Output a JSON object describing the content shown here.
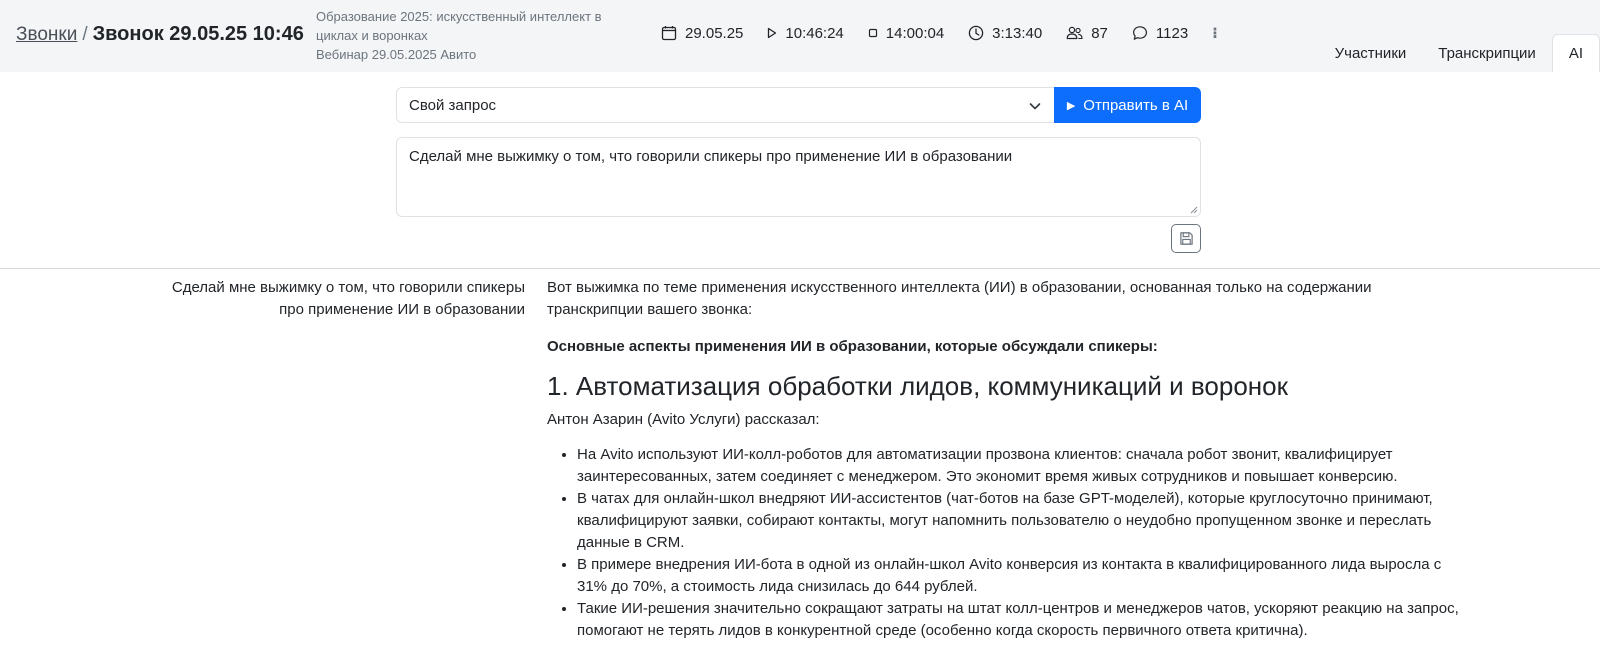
{
  "header": {
    "breadcrumb_link": "Звонки",
    "breadcrumb_sep": "/",
    "title": "Звонок 29.05.25 10:46",
    "meta_title": "Образование 2025: искусственный интеллект в циклах и воронках",
    "meta_subtitle": "Вебинар 29.05.2025 Авито",
    "stats": {
      "date": "29.05.25",
      "start_time": "10:46:24",
      "end_time": "14:00:04",
      "duration": "3:13:40",
      "participants": "87",
      "messages": "1123",
      "more": "⁝"
    },
    "tabs": [
      {
        "label": "Участники",
        "active": false
      },
      {
        "label": "Транскрипции",
        "active": false
      },
      {
        "label": "AI",
        "active": true
      }
    ]
  },
  "query": {
    "select_value": "Свой запрос",
    "send_label": "Отправить в AI",
    "prompt_text": "Сделай мне выжимку о том, что говорили спикеры про применение ИИ в образовании"
  },
  "conversation": {
    "question": "Сделай мне выжимку о том, что говорили спикеры про применение ИИ в образовании",
    "intro": "Вот выжимка по теме применения искусственного интеллекта (ИИ) в образовании, основанная только на содержании транскрипции вашего звонка:",
    "section_heading": "Основные аспекты применения ИИ в образовании, которые обсуждали спикеры:",
    "h1": "1. Автоматизация обработки лидов, коммуникаций и воронок",
    "speaker_line": "Антон Азарин (Avito Услуги) рассказал:",
    "bullets": [
      "На Avito используют ИИ-колл-роботов для автоматизации прозвона клиентов: сначала робот звонит, квалифицирует заинтересованных, затем соединяет с менеджером. Это экономит время живых сотрудников и повышает конверсию.",
      "В чатах для онлайн-школ внедряют ИИ-ассистентов (чат-ботов на базе GPT-моделей), которые круглосуточно принимают, квалифицируют заявки, собирают контакты, могут напомнить пользователю о неудобно пропущенном звонке и переслать данные в CRM.",
      "В примере внедрения ИИ-бота в одной из онлайн-школ Avito конверсия из контакта в квалифицированного лида выросла с 31% до 70%, а стоимость лида снизилась до 644 рублей.",
      "Такие ИИ-решения значительно сокращают затраты на штат колл-центров и менеджеров чатов, ускоряют реакцию на запрос, помогают не терять лидов в конкурентной среде (особенно когда скорость первичного ответа критична)."
    ]
  },
  "colors": {
    "accent": "#0d6efd",
    "header_bg": "#f4f5f7",
    "text": "#212529",
    "muted": "#6c757d"
  },
  "icons": [
    "calendar-icon",
    "play-icon",
    "stop-icon",
    "clock-icon",
    "people-icon",
    "chat-icon",
    "more-icon",
    "chevron-down-icon",
    "save-icon"
  ]
}
